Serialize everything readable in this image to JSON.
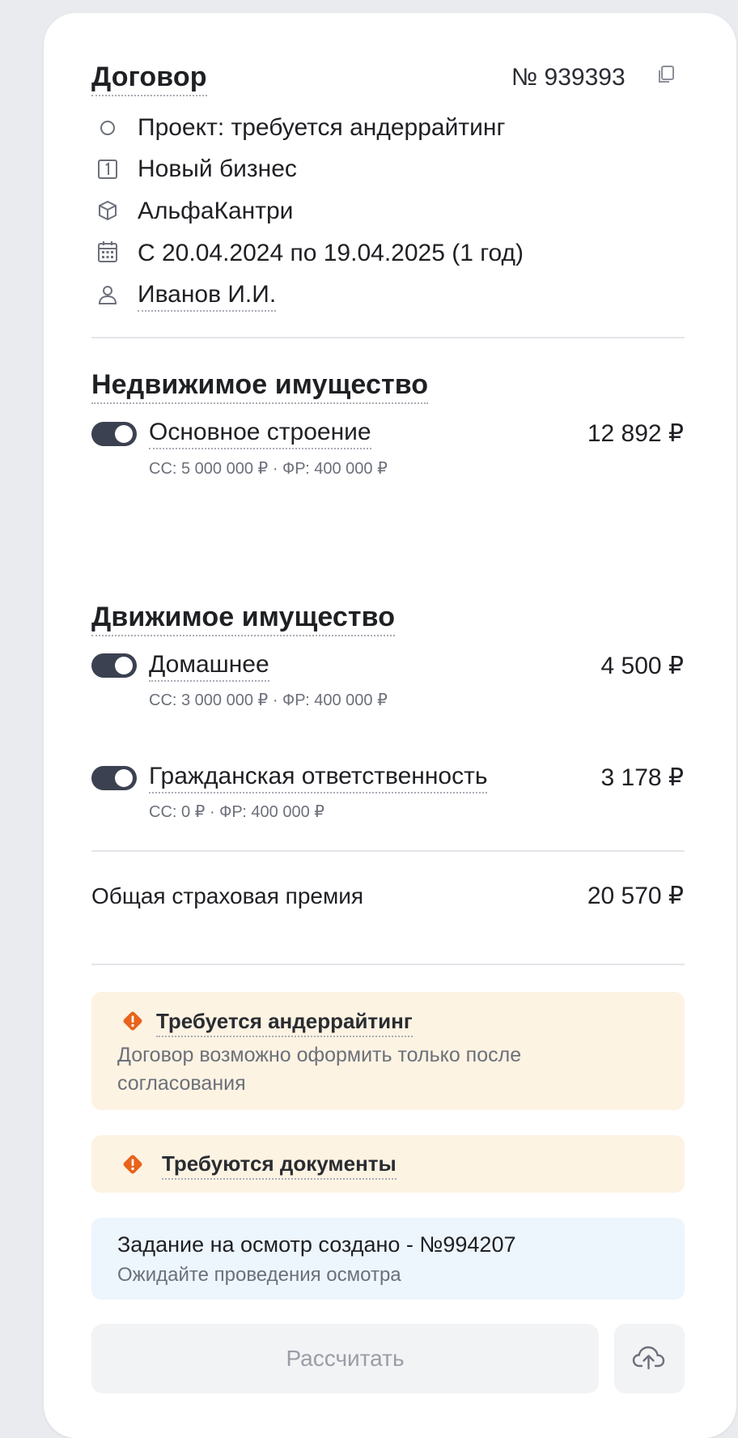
{
  "contract": {
    "title": "Договор",
    "number": "№ 939393",
    "status": "Проект: требуется андеррайтинг",
    "business_type": "Новый бизнес",
    "product": "АльфаКантри",
    "period": "С 20.04.2024 по 19.04.2025 (1 год)",
    "manager": "Иванов И.И."
  },
  "real_estate": {
    "title": "Недвижимое имущество",
    "items": [
      {
        "name": "Основное строение",
        "details": "СС: 5 000 000 ₽ · ФР: 400 000 ₽",
        "price": "12 892 ₽",
        "enabled": true
      }
    ]
  },
  "movable": {
    "title": "Движимое имущество",
    "items": [
      {
        "name": "Домашнее",
        "details": "СС: 3 000 000 ₽ · ФР: 400 000 ₽",
        "price": "4 500 ₽",
        "enabled": true
      },
      {
        "name": "Гражданская ответственность",
        "details": "СС: 0 ₽ · ФР: 400 000 ₽",
        "price": "3 178 ₽",
        "enabled": true
      }
    ]
  },
  "total": {
    "label": "Общая страховая премия",
    "value": "20 570 ₽"
  },
  "alerts": {
    "underwriting_title": "Требуется андеррайтинг",
    "underwriting_text": "Договор возможно оформить только после согласования",
    "documents_title": "Требуются документы",
    "inspection_title": "Задание на осмотр создано - №994207",
    "inspection_text": "Ожидайте проведения осмотра"
  },
  "actions": {
    "calculate_label": "Рассчитать"
  },
  "icons": {
    "copy": "copy-icon",
    "status": "circle-status-icon",
    "business": "number-one-icon",
    "product": "cube-icon",
    "period": "calendar-icon",
    "manager": "user-icon",
    "warning": "warning-diamond-icon",
    "upload": "cloud-upload-icon"
  },
  "colors": {
    "toggle_on": "#3b4150",
    "warning_bg": "#fdf3e3",
    "warning_icon": "#e8641b",
    "info_bg": "#edf5fd"
  }
}
